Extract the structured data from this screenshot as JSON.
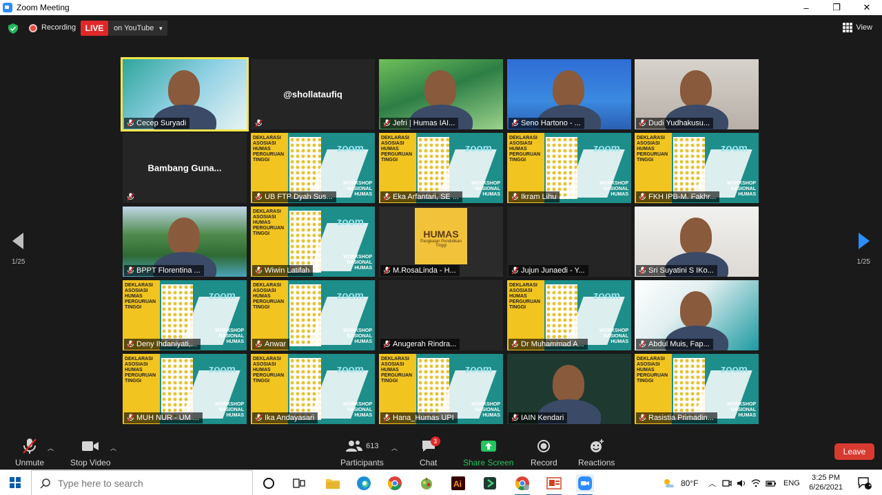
{
  "window": {
    "title": "Zoom Meeting",
    "minimize": "–",
    "maximize": "❐",
    "close": "✕"
  },
  "top": {
    "recording_label": "Recording",
    "live_label": "LIVE",
    "youtube_label": "on YouTube",
    "view_label": "View"
  },
  "gallery": {
    "page_left": "1/25",
    "page_right": "1/25",
    "tiles": [
      {
        "name": "Cecep Suryadi",
        "kind": "video",
        "bg": "p-teal",
        "active": true
      },
      {
        "name": "@shollataufiq",
        "kind": "namecard",
        "label": ""
      },
      {
        "name": "Jefri | Humas IAI...",
        "kind": "video",
        "bg": "p-green"
      },
      {
        "name": "Seno Hartono - ...",
        "kind": "video",
        "bg": "p-blue"
      },
      {
        "name": "Dudi Yudhakusu...",
        "kind": "video",
        "bg": "p-office"
      },
      {
        "name": "Bambang  Guna...",
        "kind": "namecard",
        "label": ""
      },
      {
        "name": "UB FTP Dyah Sus...",
        "kind": "poster"
      },
      {
        "name": "Eka Arfantari, SE ...",
        "kind": "poster"
      },
      {
        "name": "Ikram Lihu",
        "kind": "poster"
      },
      {
        "name": "FKH IPB-M. Fakhr...",
        "kind": "poster"
      },
      {
        "name": "BPPT Florentina  ...",
        "kind": "video",
        "bg": "p-lake"
      },
      {
        "name": "Wiwin Latifah",
        "kind": "poster"
      },
      {
        "name": "M.RosaLinda - H...",
        "kind": "humas"
      },
      {
        "name": "Jujun Junaedi - Y...",
        "kind": "blank"
      },
      {
        "name": "Sri Suyatini S IKo...",
        "kind": "video",
        "bg": "p-wall"
      },
      {
        "name": "Deny Ihdaniyati,...",
        "kind": "poster"
      },
      {
        "name": "Anwar",
        "kind": "poster"
      },
      {
        "name": "Anugerah Rindra...",
        "kind": "blank"
      },
      {
        "name": "Dr Muhammad A...",
        "kind": "poster"
      },
      {
        "name": "Abdul Muis, Fap...",
        "kind": "video",
        "bg": "p-white"
      },
      {
        "name": "MUH NUR - UM ...",
        "kind": "poster"
      },
      {
        "name": "Ika Andayasari",
        "kind": "poster"
      },
      {
        "name": "Hana_Humas UPI",
        "kind": "poster"
      },
      {
        "name": "IAIN Kendari",
        "kind": "video",
        "bg": "p-dark-green"
      },
      {
        "name": "Rasistia Primadin...",
        "kind": "poster"
      }
    ],
    "poster": {
      "left_text": "DEKLARASI ASOSIASI HUMAS PERGURUAN TINGGI",
      "zoom": "zoom",
      "workshop": "WORKSHOP NASIONAL HUMAS"
    },
    "humas": {
      "title": "HUMAS",
      "subtitle": "Pangkalan Pendidikan Tinggi"
    }
  },
  "toolbar": {
    "unmute": "Unmute",
    "stop_video": "Stop Video",
    "participants_count": "613",
    "participants": "Participants",
    "chat": "Chat",
    "chat_badge": "3",
    "share_screen": "Share Screen",
    "record": "Record",
    "reactions": "Reactions",
    "leave": "Leave"
  },
  "taskbar": {
    "search_placeholder": "Type here to search",
    "weather": "80°F",
    "language": "ENG",
    "time": "3:25 PM",
    "date": "6/26/2021",
    "notifications": "2"
  },
  "colors": {
    "accent": "#2d8cff",
    "live": "#e02828",
    "leave": "#d93a30",
    "active_speaker": "#f5e649",
    "share_green": "#23c55e"
  }
}
